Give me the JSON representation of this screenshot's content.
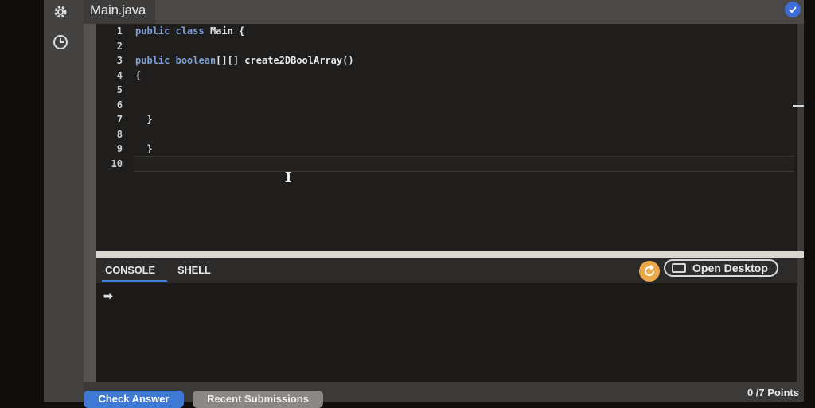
{
  "sidebar": {
    "icons": [
      {
        "name": "gear-icon"
      },
      {
        "name": "clock-icon"
      }
    ]
  },
  "editor": {
    "file_tab": "Main.java",
    "line_numbers": [
      "1",
      "2",
      "3",
      "4",
      "5",
      "6",
      "7",
      "8",
      "9",
      "10"
    ],
    "lines": [
      "public class Main {",
      "",
      "public boolean[][] create2DBoolArray()",
      "{",
      "",
      "",
      "  }",
      "",
      "  }",
      ""
    ]
  },
  "console": {
    "tabs": [
      "CONSOLE",
      "SHELL"
    ],
    "active_tab": "CONSOLE",
    "open_desktop_label": "Open Desktop",
    "prompt": "➡"
  },
  "footer": {
    "check_answer_label": "Check Answer",
    "recent_submissions_label": "Recent Submissions",
    "points_text": "0  /7 Points"
  },
  "colors": {
    "accent": "#3f79d6",
    "refresh": "#e9a84a",
    "editor_bg": "#1f1e1d",
    "keyword": "#7f9fd6"
  }
}
